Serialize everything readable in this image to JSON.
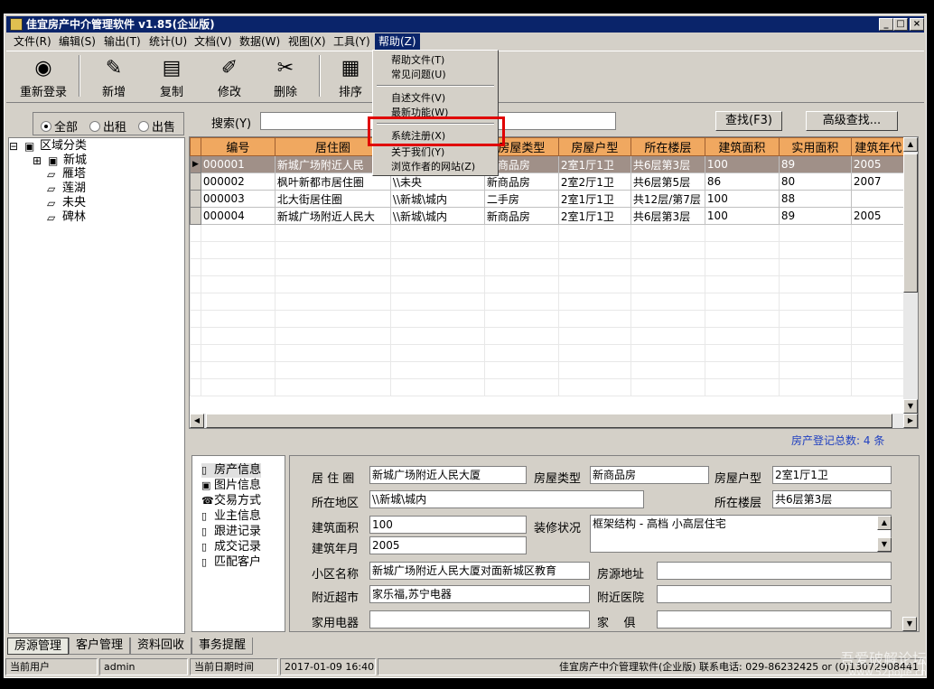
{
  "window": {
    "title": "佳宜房产中介管理软件 v1.85(企业版)"
  },
  "menu": [
    "文件(R)",
    "编辑(S)",
    "输出(T)",
    "统计(U)",
    "文档(V)",
    "数据(W)",
    "视图(X)",
    "工具(Y)",
    "帮助(Z)"
  ],
  "toolbar": [
    {
      "label": "重新登录",
      "icon": "◉"
    },
    {
      "label": "新增",
      "icon": "✎"
    },
    {
      "label": "复制",
      "icon": "▤"
    },
    {
      "label": "修改",
      "icon": "✐"
    },
    {
      "label": "删除",
      "icon": "✂"
    },
    {
      "label": "排序",
      "icon": "▦"
    }
  ],
  "help_menu": [
    "帮助文件(T)",
    "常见问题(U)",
    "自述文件(V)",
    "最新功能(W)",
    "系统注册(X)",
    "关于我们(Y)",
    "浏览作者的网站(Z)"
  ],
  "filter": {
    "all": "全部",
    "rent": "出租",
    "sell": "出售"
  },
  "tree": {
    "root": "区域分类",
    "items": [
      "新城",
      "雁塔",
      "莲湖",
      "未央",
      "碑林"
    ]
  },
  "search": {
    "label": "搜索(Y)",
    "value": "",
    "find_button": "查找(F3)",
    "advanced_button": "高级查找..."
  },
  "table": {
    "columns": [
      "编号",
      "居住圈",
      "",
      "房屋类型",
      "房屋户型",
      "所在楼层",
      "建筑面积",
      "实用面积",
      "建筑年代"
    ],
    "rows": [
      [
        "000001",
        "新城广场附近人民",
        "",
        "新商品房",
        "2室1厅1卫",
        "共6层第3层",
        "100",
        "89",
        "2005"
      ],
      [
        "000002",
        "枫叶新都市居住圈",
        "\\\\未央",
        "新商品房",
        "2室2厅1卫",
        "共6层第5层",
        "86",
        "80",
        "2007"
      ],
      [
        "000003",
        "北大街居住圈",
        "\\\\新城\\城内",
        "二手房",
        "2室1厅1卫",
        "共12层/第7层",
        "100",
        "88",
        ""
      ],
      [
        "000004",
        "新城广场附近人民大",
        "\\\\新城\\城内",
        "新商品房",
        "2室1厅1卫",
        "共6层第3层",
        "100",
        "89",
        "2005"
      ]
    ]
  },
  "count": {
    "label": "房产登记总数:",
    "value": "4",
    "unit": "条"
  },
  "categories": [
    "房产信息",
    "图片信息",
    "交易方式",
    "业主信息",
    "跟进记录",
    "成交记录",
    "匹配客户"
  ],
  "detail": {
    "l_circle": "居 住 圈",
    "v_circle": "新城广场附近人民大厦",
    "l_type": "房屋类型",
    "v_type": "新商品房",
    "l_layout": "房屋户型",
    "v_layout": "2室1厅1卫",
    "l_area": "所在地区",
    "v_area": "\\\\新城\\城内",
    "l_floor": "所在楼层",
    "v_floor": "共6层第3层",
    "l_build_area": "建筑面积",
    "v_build_area": "100",
    "l_decor": "装修状况",
    "v_decor": "框架结构 - 高档 小高层住宅",
    "l_year": "建筑年月",
    "v_year": "2005",
    "l_estate": "小区名称",
    "v_estate": "新城广场附近人民大厦对面新城区教育",
    "l_addr": "房源地址",
    "v_addr": "",
    "l_market": "附近超市",
    "v_market": "家乐福,苏宁电器",
    "l_hospital": "附近医院",
    "v_hospital": "",
    "l_appliance": "家用电器",
    "v_appliance": "",
    "l_furniture": "家    俱",
    "v_furniture": ""
  },
  "tabs": [
    "房源管理",
    "客户管理",
    "资料回收",
    "事务提醒"
  ],
  "status": {
    "user_label": "当前用户",
    "user": "admin",
    "date_label": "当前日期时间",
    "date": "2017-01-09 16:40:57",
    "info": "佳宜房产中介管理软件(企业版) 联系电话: 029-86232425 or (0)13072908441"
  },
  "watermark": {
    "line1": "吾爱破解论坛",
    "line2": "www.52pojie.cn"
  }
}
